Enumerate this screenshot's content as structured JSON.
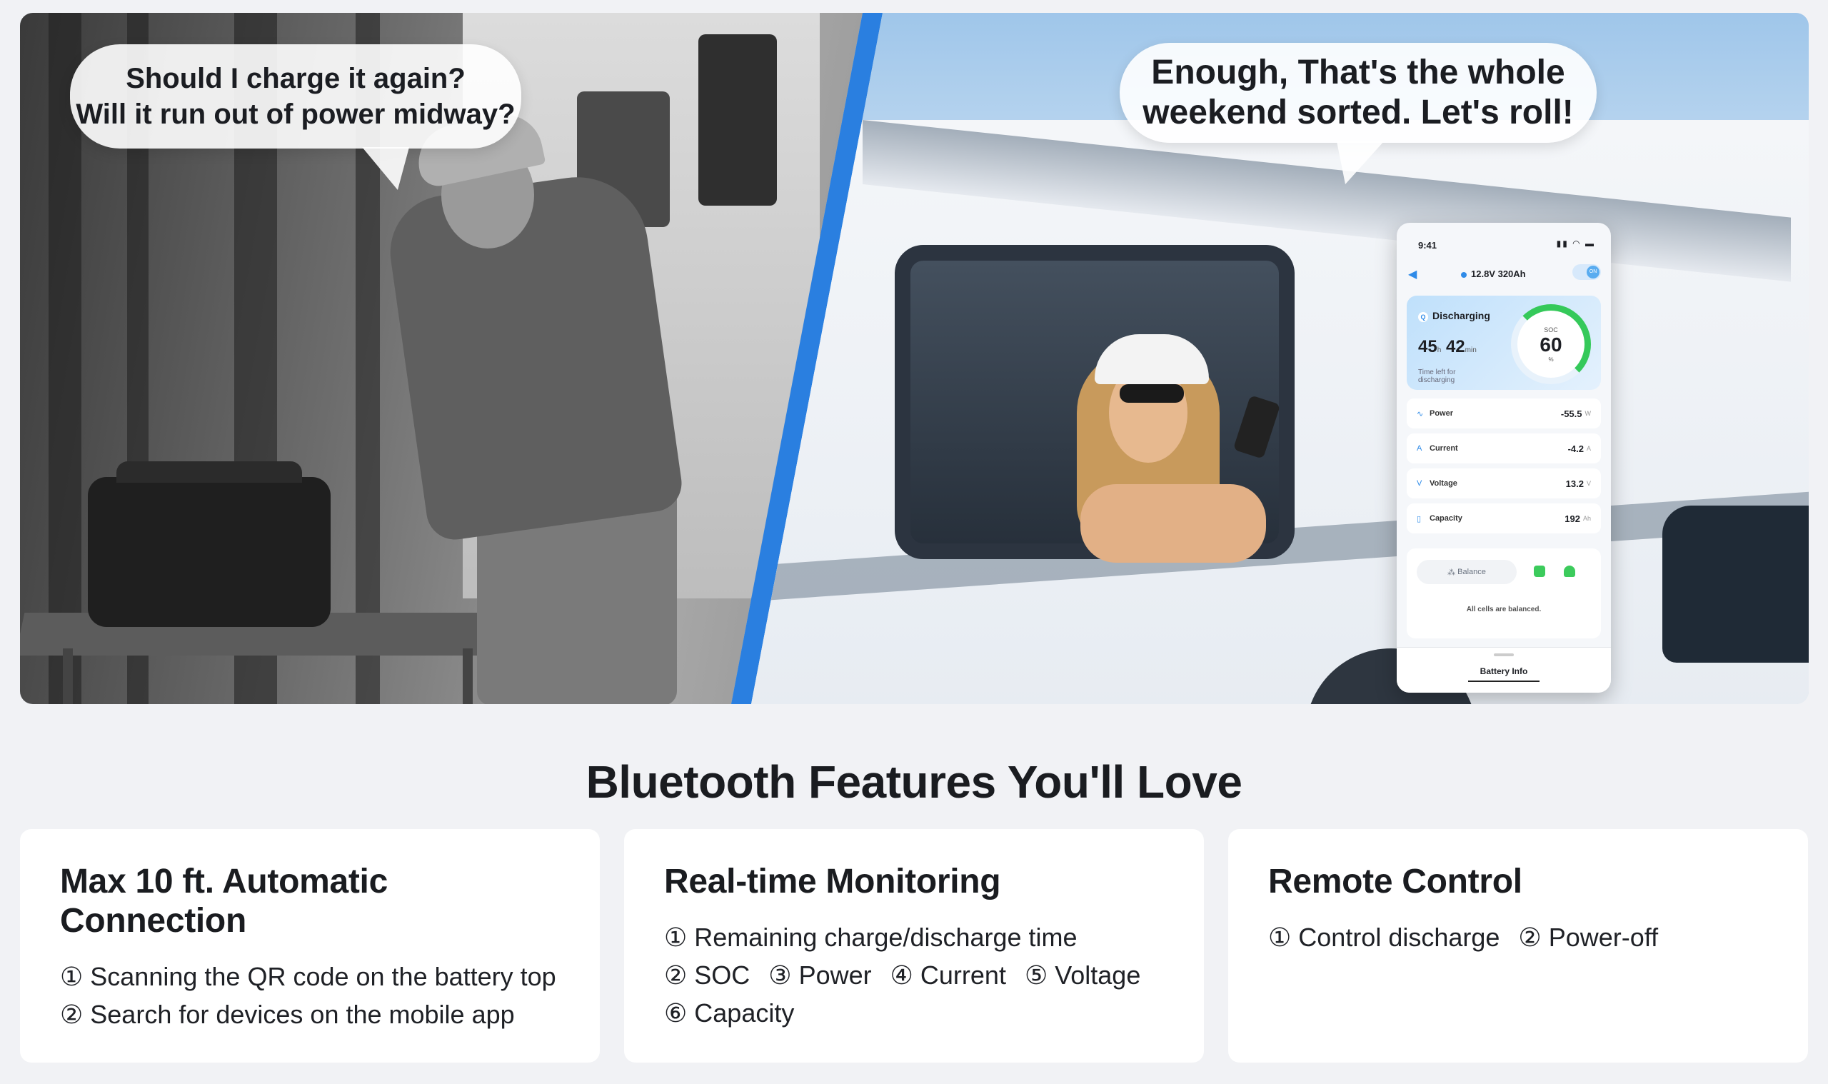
{
  "hero": {
    "left_bubble": {
      "line1": "Should I charge it again?",
      "line2": "Will it run out of power midway?"
    },
    "right_bubble": {
      "line1": "Enough, That's the whole",
      "line2": "weekend sorted. Let's roll!"
    },
    "accent_color": "#2a7fe0"
  },
  "phone": {
    "time": "9:41",
    "device_title": "12.8V 320Ah",
    "toggle_label": "ON",
    "status": "Discharging",
    "remaining_hours": "45",
    "hours_unit": "h",
    "remaining_minutes": "42",
    "minutes_unit": "min",
    "time_left_label": "Time left for discharging",
    "soc_label": "SOC",
    "soc_value": "60",
    "soc_unit": "%",
    "rows": [
      {
        "name": "Power",
        "value": "-55.5",
        "unit": "W"
      },
      {
        "name": "Current",
        "value": "-4.2",
        "unit": "A"
      },
      {
        "name": "Voltage",
        "value": "13.2",
        "unit": "V"
      },
      {
        "name": "Capacity",
        "value": "192",
        "unit": "Ah"
      }
    ],
    "balance_label": "Balance",
    "balance_message": "All cells are balanced.",
    "footer_tab": "Battery Info"
  },
  "section_title": "Bluetooth Features You'll Love",
  "cards": [
    {
      "title": "Max 10 ft. Automatic Connection",
      "items": [
        "① Scanning the QR code on the battery top",
        "② Search for devices on the mobile app"
      ]
    },
    {
      "title": "Real-time Monitoring",
      "items": [
        "① Remaining charge/discharge time",
        "② SOC",
        "③ Power",
        "④ Current",
        "⑤ Voltage",
        "⑥ Capacity"
      ]
    },
    {
      "title": "Remote Control",
      "items": [
        "① Control discharge",
        "② Power-off"
      ]
    }
  ]
}
